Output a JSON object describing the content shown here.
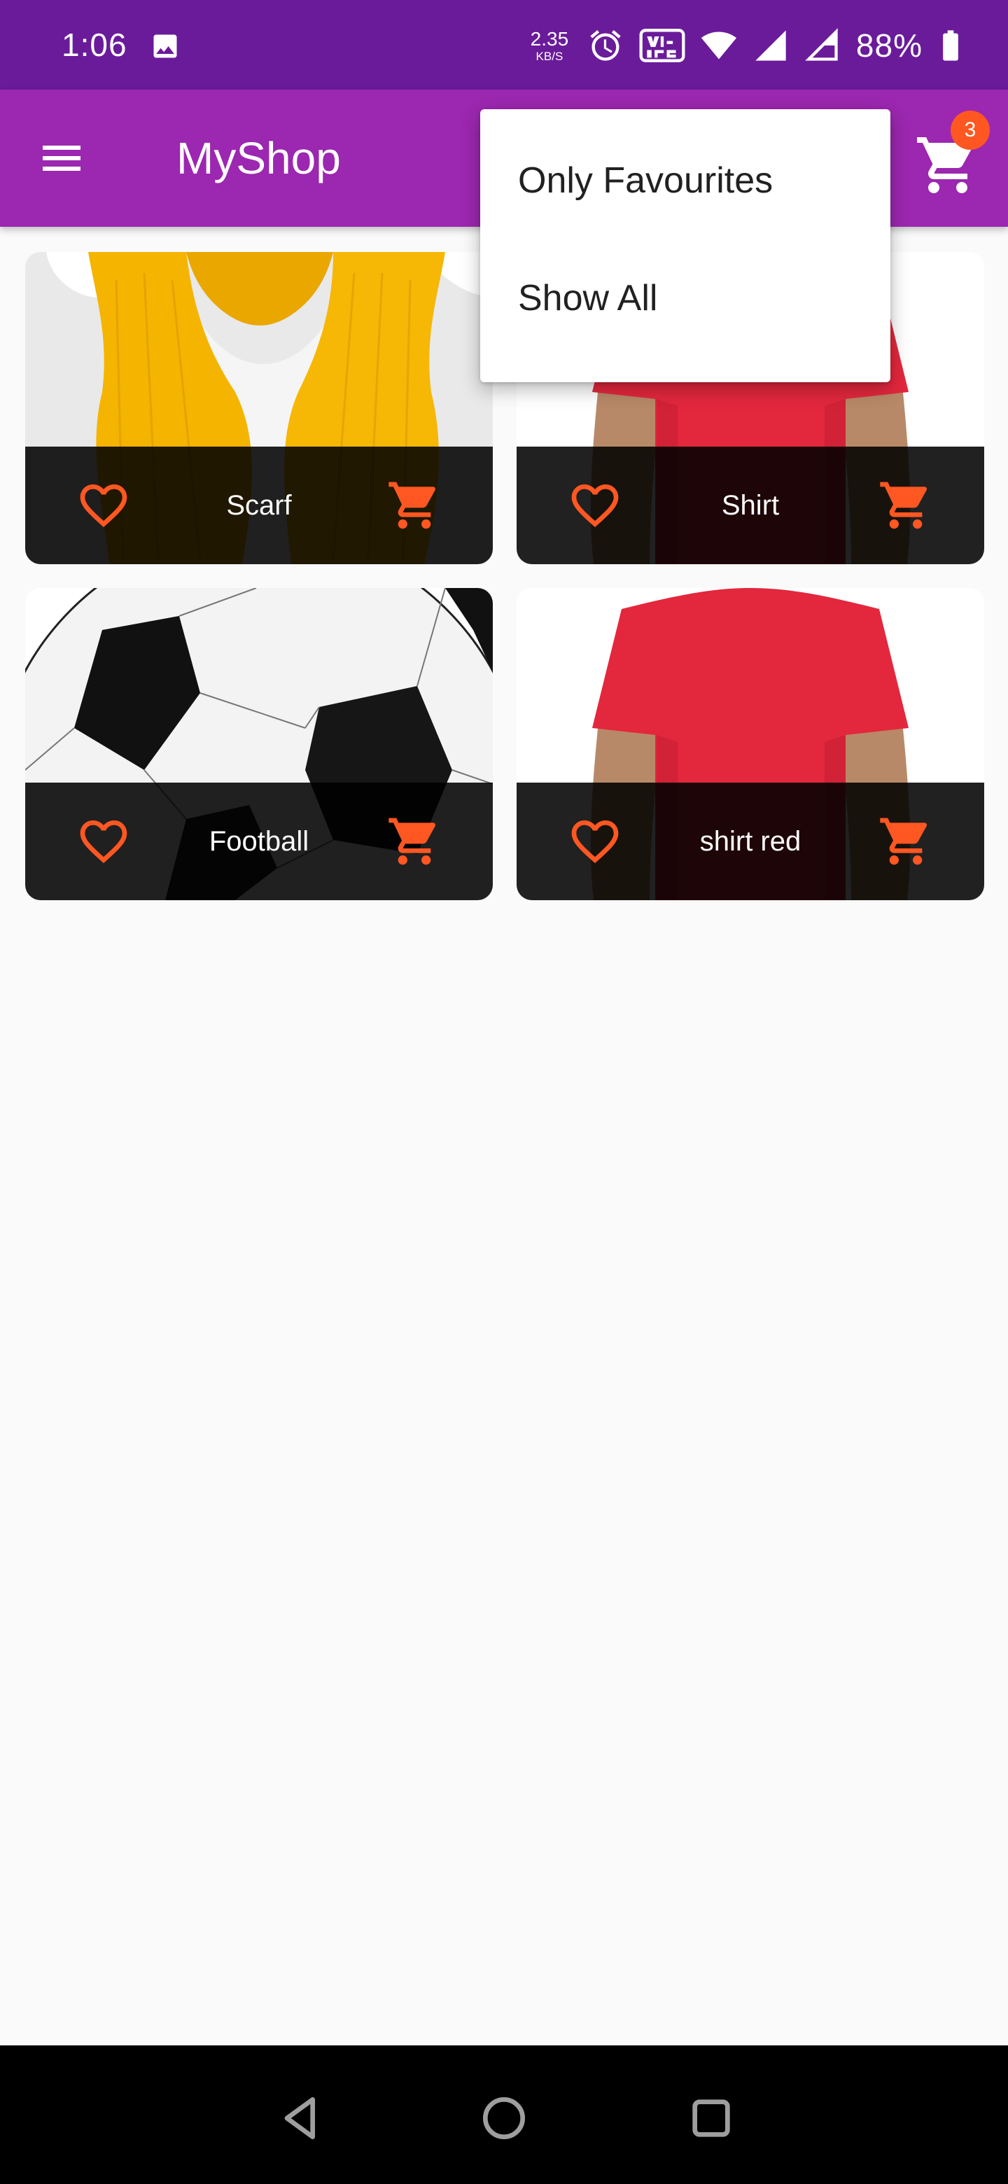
{
  "status_bar": {
    "time": "1:06",
    "net_speed_value": "2.35",
    "net_speed_unit": "KB/S",
    "battery": "88%"
  },
  "app_bar": {
    "title": "MyShop",
    "cart_count": "3"
  },
  "colors": {
    "status_bar": "#6a1b9a",
    "app_bar": "#9c27b0",
    "accent": "#ff5722",
    "background": "#fafafa"
  },
  "menu": {
    "items": [
      "Only Favourites",
      "Show All"
    ]
  },
  "products": [
    {
      "title": "Scarf",
      "image": "yellow-scarf"
    },
    {
      "title": "Shirt",
      "image": "red-tshirt"
    },
    {
      "title": "Football",
      "image": "football"
    },
    {
      "title": "shirt red",
      "image": "red-tshirt"
    }
  ],
  "icons": {
    "menu": "hamburger-menu-icon",
    "cart": "shopping-cart-icon",
    "favourite": "heart-outline-icon",
    "add_to_cart": "shopping-cart-icon",
    "nav_back": "triangle-back-icon",
    "nav_home": "circle-home-icon",
    "nav_recents": "square-recents-icon"
  }
}
